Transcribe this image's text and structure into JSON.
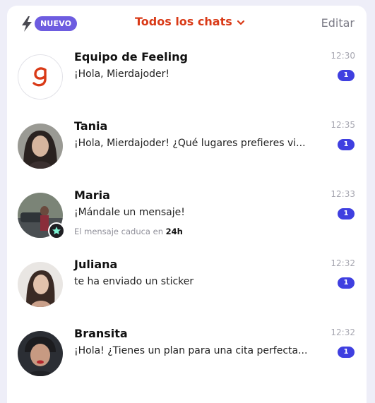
{
  "header": {
    "new_badge": "NUEVO",
    "title": "Todos los chats",
    "edit_label": "Editar",
    "accent_color": "#d93a17",
    "badge_color": "#6d5ce0"
  },
  "chats": [
    {
      "name": "Equipo de Feeling",
      "message": "¡Hola, Mierdajoder!",
      "time": "12:30",
      "unread": "1"
    },
    {
      "name": "Tania",
      "message": "¡Hola, Mierdajoder! ¿Qué lugares prefieres vi...",
      "time": "12:35",
      "unread": "1"
    },
    {
      "name": "Maria",
      "message": "¡Mándale un mensaje!",
      "time": "12:33",
      "unread": "1",
      "expiry_prefix": "El mensaje caduca en",
      "expiry_value": "24h"
    },
    {
      "name": "Juliana",
      "message": "te ha enviado un sticker",
      "time": "12:32",
      "unread": "1"
    },
    {
      "name": "Bransita",
      "message": "¡Hola! ¿Tienes un plan para una cita perfecta...",
      "time": "12:32",
      "unread": "1"
    }
  ],
  "icons": {
    "bolt": "lightning-icon",
    "chevron": "chevron-down-icon",
    "star": "star-icon",
    "logo": "feeling-logo"
  },
  "unread_color": "#3f3fe0"
}
